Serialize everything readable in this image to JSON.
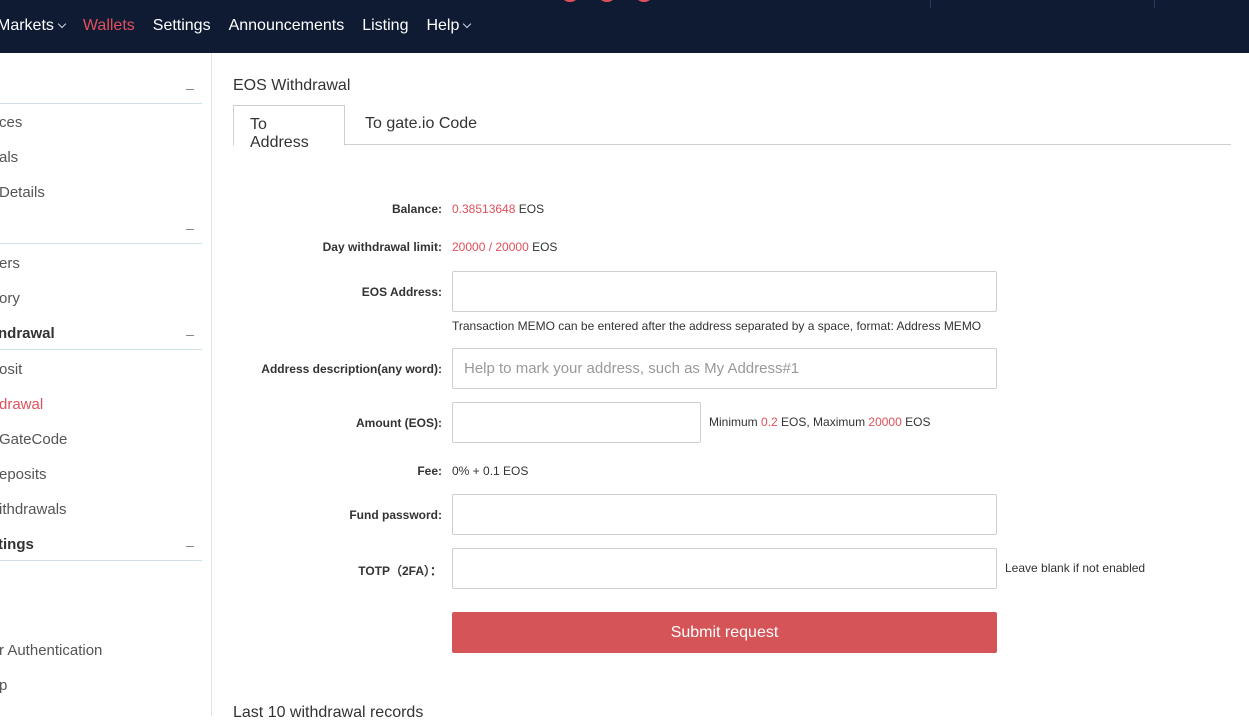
{
  "topnav": {
    "items": [
      {
        "label": "Markets",
        "dropdown": true,
        "active": false
      },
      {
        "label": "Wallets",
        "dropdown": false,
        "active": true
      },
      {
        "label": "Settings",
        "dropdown": false,
        "active": false
      },
      {
        "label": "Announcements",
        "dropdown": false,
        "active": false
      },
      {
        "label": "Listing",
        "dropdown": false,
        "active": false
      },
      {
        "label": "Help",
        "dropdown": true,
        "active": false
      }
    ]
  },
  "sidebar": {
    "sections": [
      {
        "title": "",
        "items": [
          "ces",
          "als",
          " Details"
        ]
      },
      {
        "title": "",
        "items": [
          "ers",
          "ory"
        ]
      },
      {
        "title": "ndrawal",
        "items": [
          "osit",
          "drawal",
          "GateCode",
          "eposits",
          "ithdrawals"
        ]
      },
      {
        "title": "tings",
        "items": [
          "",
          "",
          "r Authentication",
          "p"
        ]
      }
    ]
  },
  "main": {
    "title": "EOS Withdrawal",
    "tabs": [
      {
        "label": "To Address",
        "active": true
      },
      {
        "label": "To gate.io Code",
        "active": false
      }
    ],
    "form": {
      "balance_label": "Balance:",
      "balance_value": "0.38513648",
      "balance_unit": "EOS",
      "limit_label": "Day withdrawal limit:",
      "limit_value": "20000 / 20000",
      "limit_unit": "EOS",
      "address_label": "EOS Address:",
      "address_value": "",
      "memo_hint": "Transaction MEMO can be entered after the address separated by a space, format: Address MEMO",
      "desc_label": "Address description(any word):",
      "desc_placeholder": "Help to mark your address, such as My Address#1",
      "amount_label": "Amount (EOS):",
      "amount_value": "",
      "min_prefix": "Minimum",
      "min_value": "0.2",
      "min_unit": "EOS, Maximum",
      "max_value": "20000",
      "max_unit": "EOS",
      "fee_label": "Fee:",
      "fee_value": "0% + 0.1 EOS",
      "fund_label": "Fund password:",
      "totp_label": "TOTP（2FA）：",
      "totp_hint": "Leave blank if not enabled",
      "submit_label": "Submit request"
    },
    "records_title": "Last 10 withdrawal records"
  },
  "colors": {
    "topbar_bg": "#0f1b33",
    "accent": "#e0505b",
    "submit_bg": "#d55458"
  }
}
